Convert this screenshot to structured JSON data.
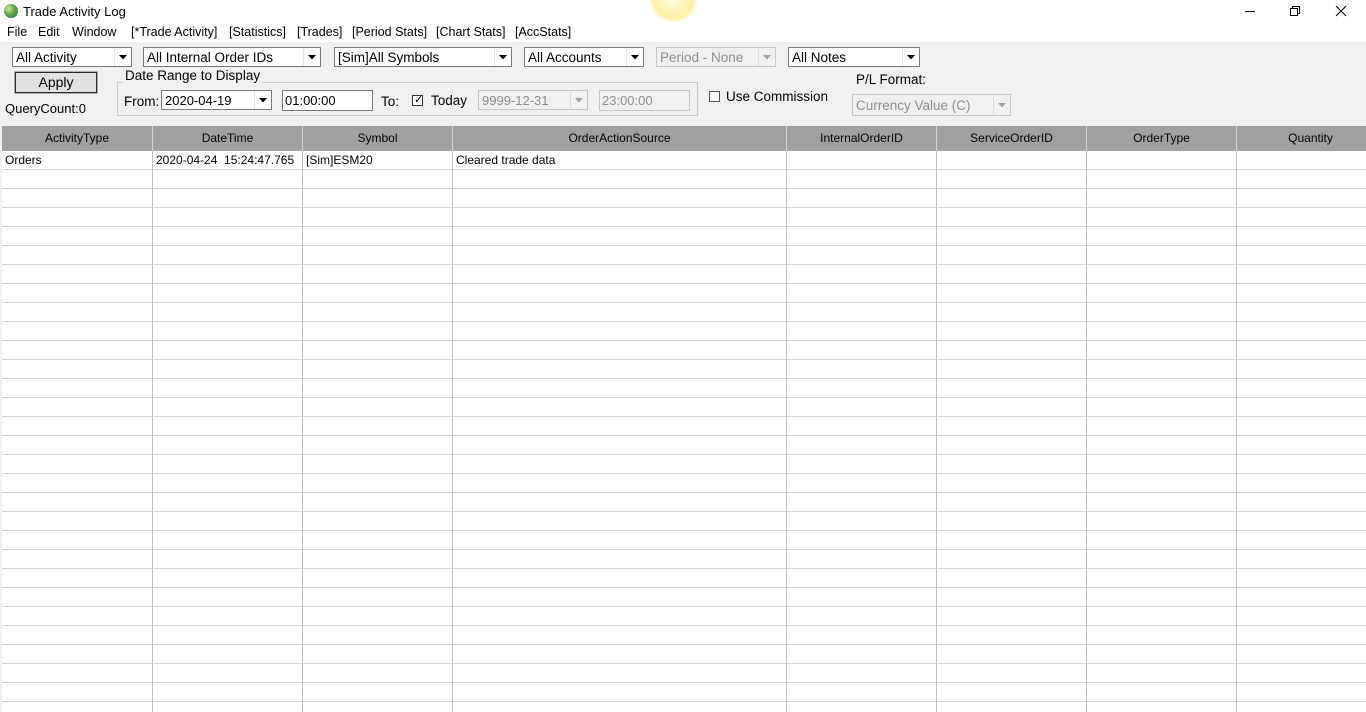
{
  "window": {
    "title": "Trade Activity Log",
    "icons": {
      "app": "globe-icon",
      "minimize": "minimize-icon",
      "restore": "restore-icon",
      "close": "close-icon"
    }
  },
  "menu": [
    "File",
    "Edit",
    "Window",
    "[*Trade Activity]",
    "[Statistics]",
    "[Trades]",
    "[Period Stats]",
    "[Chart Stats]",
    "[AccStats]"
  ],
  "filters": {
    "activity": "All Activity",
    "internal_order_ids": "All Internal Order IDs",
    "symbols": "[Sim]All Symbols",
    "accounts": "All Accounts",
    "period": "Period - None",
    "notes": "All Notes"
  },
  "apply_label": "Apply",
  "query_count": "QueryCount:0",
  "date_range": {
    "legend": "Date Range to Display",
    "from_label": "From:",
    "from_date": "2020-04-19",
    "from_time": "01:00:00",
    "to_label": "To:",
    "today_checked": true,
    "today_label": "Today",
    "to_date": "9999-12-31",
    "to_time": "23:00:00"
  },
  "use_commission": {
    "label": "Use Commission",
    "checked": false
  },
  "pl_format": {
    "label": "P/L Format:",
    "value": "Currency Value (C)"
  },
  "table": {
    "columns": [
      "ActivityType",
      "DateTime",
      "Symbol",
      "OrderActionSource",
      "InternalOrderID",
      "ServiceOrderID",
      "OrderType",
      "Quantity"
    ],
    "rows": [
      [
        "Orders",
        "2020-04-24  15:24:47.765",
        "[Sim]ESM20",
        "Cleared trade data",
        "",
        "",
        "",
        ""
      ]
    ]
  },
  "colors": {
    "header_bg": "#a0a0a0",
    "grid_line": "#d2d2d2",
    "window_bg": "#f0f0f0"
  }
}
